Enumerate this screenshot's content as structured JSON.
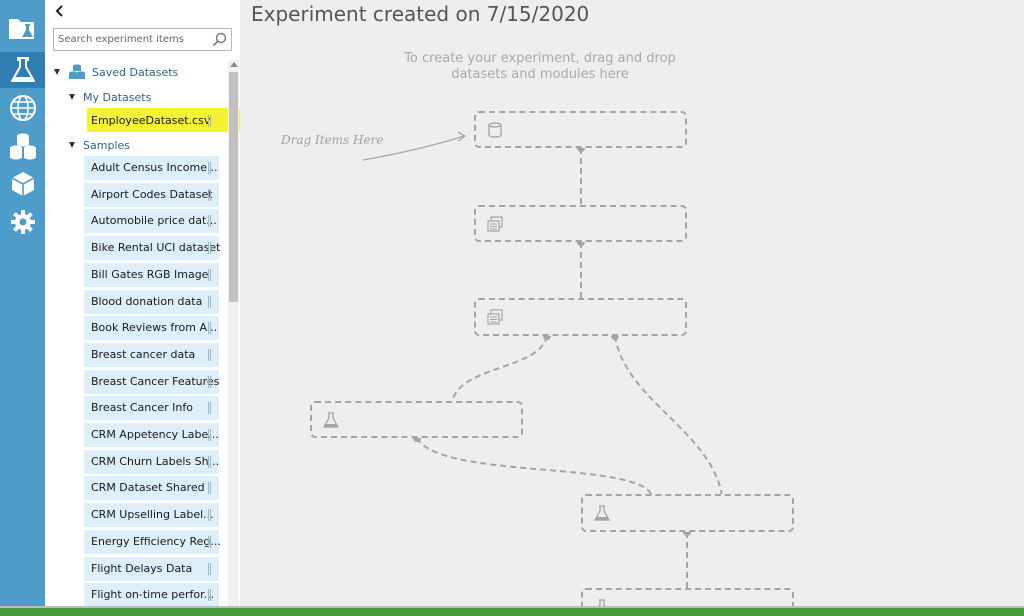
{
  "rail": {
    "items": [
      {
        "name": "projects-icon",
        "active": false
      },
      {
        "name": "experiments-icon",
        "active": true
      },
      {
        "name": "web-services-icon",
        "active": false
      },
      {
        "name": "datasets-icon",
        "active": false
      },
      {
        "name": "trained-models-icon",
        "active": false
      },
      {
        "name": "settings-icon",
        "active": false
      }
    ]
  },
  "palette": {
    "search_placeholder": "Search experiment items",
    "saved_datasets": "Saved Datasets",
    "my_datasets": "My Datasets",
    "my_dataset_items": [
      "EmployeeDataset.csv"
    ],
    "samples": "Samples",
    "sample_items": [
      "Adult Census Income...",
      "Airport Codes Dataset",
      "Automobile price dat...",
      "Bike Rental UCI dataset",
      "Bill Gates RGB Image",
      "Blood donation data",
      "Book Reviews from A...",
      "Breast cancer data",
      "Breast Cancer Features",
      "Breast Cancer Info",
      "CRM Appetency Labe...",
      "CRM Churn Labels Sh...",
      "CRM Dataset Shared",
      "CRM Upselling Label...",
      "Energy Efficiency Reg...",
      "Flight Delays Data",
      "Flight on-time perfor..."
    ]
  },
  "canvas": {
    "title": "Experiment created on 7/15/2020",
    "hint": "To create your experiment, drag and drop datasets and modules here",
    "drag_hint": "Drag Items Here"
  },
  "colors": {
    "rail": "#4e9cc9",
    "rail_active": "#2f7db1",
    "item_bg": "#ddeff8",
    "highlight": "#f3f00e",
    "tree_label": "#2a6595",
    "status_bar": "#4a9b3e"
  }
}
